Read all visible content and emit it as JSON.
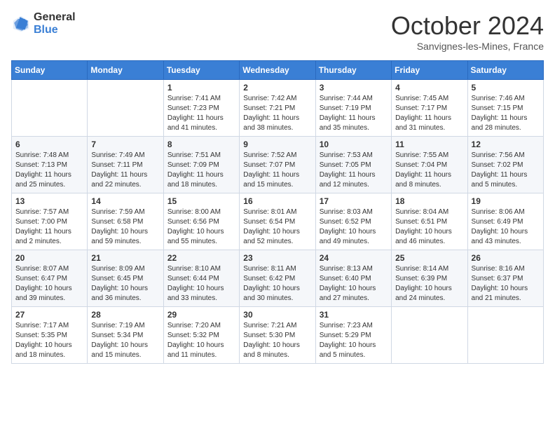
{
  "header": {
    "logo_general": "General",
    "logo_blue": "Blue",
    "month_title": "October 2024",
    "subtitle": "Sanvignes-les-Mines, France"
  },
  "weekdays": [
    "Sunday",
    "Monday",
    "Tuesday",
    "Wednesday",
    "Thursday",
    "Friday",
    "Saturday"
  ],
  "weeks": [
    [
      {
        "day": "",
        "info": ""
      },
      {
        "day": "",
        "info": ""
      },
      {
        "day": "1",
        "info": "Sunrise: 7:41 AM\nSunset: 7:23 PM\nDaylight: 11 hours and 41 minutes."
      },
      {
        "day": "2",
        "info": "Sunrise: 7:42 AM\nSunset: 7:21 PM\nDaylight: 11 hours and 38 minutes."
      },
      {
        "day": "3",
        "info": "Sunrise: 7:44 AM\nSunset: 7:19 PM\nDaylight: 11 hours and 35 minutes."
      },
      {
        "day": "4",
        "info": "Sunrise: 7:45 AM\nSunset: 7:17 PM\nDaylight: 11 hours and 31 minutes."
      },
      {
        "day": "5",
        "info": "Sunrise: 7:46 AM\nSunset: 7:15 PM\nDaylight: 11 hours and 28 minutes."
      }
    ],
    [
      {
        "day": "6",
        "info": "Sunrise: 7:48 AM\nSunset: 7:13 PM\nDaylight: 11 hours and 25 minutes."
      },
      {
        "day": "7",
        "info": "Sunrise: 7:49 AM\nSunset: 7:11 PM\nDaylight: 11 hours and 22 minutes."
      },
      {
        "day": "8",
        "info": "Sunrise: 7:51 AM\nSunset: 7:09 PM\nDaylight: 11 hours and 18 minutes."
      },
      {
        "day": "9",
        "info": "Sunrise: 7:52 AM\nSunset: 7:07 PM\nDaylight: 11 hours and 15 minutes."
      },
      {
        "day": "10",
        "info": "Sunrise: 7:53 AM\nSunset: 7:05 PM\nDaylight: 11 hours and 12 minutes."
      },
      {
        "day": "11",
        "info": "Sunrise: 7:55 AM\nSunset: 7:04 PM\nDaylight: 11 hours and 8 minutes."
      },
      {
        "day": "12",
        "info": "Sunrise: 7:56 AM\nSunset: 7:02 PM\nDaylight: 11 hours and 5 minutes."
      }
    ],
    [
      {
        "day": "13",
        "info": "Sunrise: 7:57 AM\nSunset: 7:00 PM\nDaylight: 11 hours and 2 minutes."
      },
      {
        "day": "14",
        "info": "Sunrise: 7:59 AM\nSunset: 6:58 PM\nDaylight: 10 hours and 59 minutes."
      },
      {
        "day": "15",
        "info": "Sunrise: 8:00 AM\nSunset: 6:56 PM\nDaylight: 10 hours and 55 minutes."
      },
      {
        "day": "16",
        "info": "Sunrise: 8:01 AM\nSunset: 6:54 PM\nDaylight: 10 hours and 52 minutes."
      },
      {
        "day": "17",
        "info": "Sunrise: 8:03 AM\nSunset: 6:52 PM\nDaylight: 10 hours and 49 minutes."
      },
      {
        "day": "18",
        "info": "Sunrise: 8:04 AM\nSunset: 6:51 PM\nDaylight: 10 hours and 46 minutes."
      },
      {
        "day": "19",
        "info": "Sunrise: 8:06 AM\nSunset: 6:49 PM\nDaylight: 10 hours and 43 minutes."
      }
    ],
    [
      {
        "day": "20",
        "info": "Sunrise: 8:07 AM\nSunset: 6:47 PM\nDaylight: 10 hours and 39 minutes."
      },
      {
        "day": "21",
        "info": "Sunrise: 8:09 AM\nSunset: 6:45 PM\nDaylight: 10 hours and 36 minutes."
      },
      {
        "day": "22",
        "info": "Sunrise: 8:10 AM\nSunset: 6:44 PM\nDaylight: 10 hours and 33 minutes."
      },
      {
        "day": "23",
        "info": "Sunrise: 8:11 AM\nSunset: 6:42 PM\nDaylight: 10 hours and 30 minutes."
      },
      {
        "day": "24",
        "info": "Sunrise: 8:13 AM\nSunset: 6:40 PM\nDaylight: 10 hours and 27 minutes."
      },
      {
        "day": "25",
        "info": "Sunrise: 8:14 AM\nSunset: 6:39 PM\nDaylight: 10 hours and 24 minutes."
      },
      {
        "day": "26",
        "info": "Sunrise: 8:16 AM\nSunset: 6:37 PM\nDaylight: 10 hours and 21 minutes."
      }
    ],
    [
      {
        "day": "27",
        "info": "Sunrise: 7:17 AM\nSunset: 5:35 PM\nDaylight: 10 hours and 18 minutes."
      },
      {
        "day": "28",
        "info": "Sunrise: 7:19 AM\nSunset: 5:34 PM\nDaylight: 10 hours and 15 minutes."
      },
      {
        "day": "29",
        "info": "Sunrise: 7:20 AM\nSunset: 5:32 PM\nDaylight: 10 hours and 11 minutes."
      },
      {
        "day": "30",
        "info": "Sunrise: 7:21 AM\nSunset: 5:30 PM\nDaylight: 10 hours and 8 minutes."
      },
      {
        "day": "31",
        "info": "Sunrise: 7:23 AM\nSunset: 5:29 PM\nDaylight: 10 hours and 5 minutes."
      },
      {
        "day": "",
        "info": ""
      },
      {
        "day": "",
        "info": ""
      }
    ]
  ]
}
